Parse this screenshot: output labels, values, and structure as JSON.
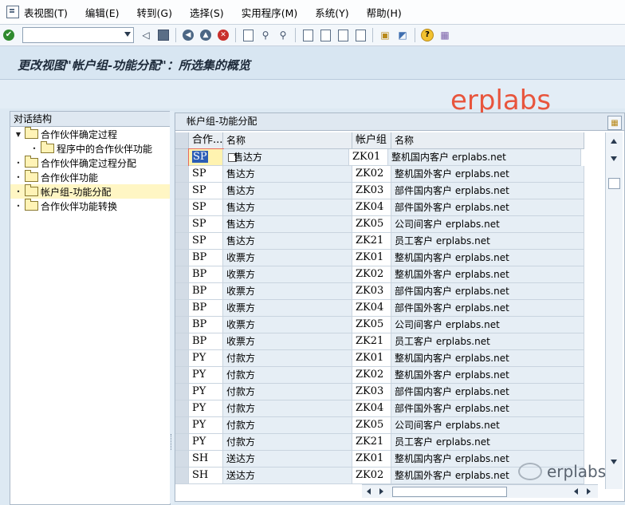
{
  "menu": [
    "表视图(T)",
    "编辑(E)",
    "转到(G)",
    "选择(S)",
    "实用程序(M)",
    "系统(Y)",
    "帮助(H)"
  ],
  "toolbar": {
    "command_value": ""
  },
  "title": "更改视图\"帐户组-功能分配\"：所选集的概览",
  "watermark_top": "erplabs",
  "tree": {
    "header": "对话结构",
    "items": [
      {
        "label": "合作伙伴确定过程",
        "toggle": "▼",
        "indent": 0
      },
      {
        "label": "程序中的合作伙伴功能",
        "toggle": "•",
        "indent": 1
      },
      {
        "label": "合作伙伴确定过程分配",
        "toggle": "•",
        "indent": 0
      },
      {
        "label": "合作伙伴功能",
        "toggle": "•",
        "indent": 0
      },
      {
        "label": "帐户组-功能分配",
        "toggle": "•",
        "indent": 0,
        "selected": true
      },
      {
        "label": "合作伙伴功能转换",
        "toggle": "•",
        "indent": 0
      }
    ]
  },
  "table": {
    "title": "帐户组-功能分配",
    "columns": [
      "合作...",
      "名称",
      "帐户组",
      "名称"
    ],
    "rows": [
      [
        "SP",
        "售达方",
        "ZK01",
        "整机国内客户 erplabs.net"
      ],
      [
        "SP",
        "售达方",
        "ZK02",
        "整机国外客户 erplabs.net"
      ],
      [
        "SP",
        "售达方",
        "ZK03",
        "部件国内客户 erplabs.net"
      ],
      [
        "SP",
        "售达方",
        "ZK04",
        "部件国外客户 erplabs.net"
      ],
      [
        "SP",
        "售达方",
        "ZK05",
        "公司间客户 erplabs.net"
      ],
      [
        "SP",
        "售达方",
        "ZK21",
        "员工客户 erplabs.net"
      ],
      [
        "BP",
        "收票方",
        "ZK01",
        "整机国内客户 erplabs.net"
      ],
      [
        "BP",
        "收票方",
        "ZK02",
        "整机国外客户 erplabs.net"
      ],
      [
        "BP",
        "收票方",
        "ZK03",
        "部件国内客户 erplabs.net"
      ],
      [
        "BP",
        "收票方",
        "ZK04",
        "部件国外客户 erplabs.net"
      ],
      [
        "BP",
        "收票方",
        "ZK05",
        "公司间客户 erplabs.net"
      ],
      [
        "BP",
        "收票方",
        "ZK21",
        "员工客户 erplabs.net"
      ],
      [
        "PY",
        "付款方",
        "ZK01",
        "整机国内客户 erplabs.net"
      ],
      [
        "PY",
        "付款方",
        "ZK02",
        "整机国外客户 erplabs.net"
      ],
      [
        "PY",
        "付款方",
        "ZK03",
        "部件国内客户 erplabs.net"
      ],
      [
        "PY",
        "付款方",
        "ZK04",
        "部件国外客户 erplabs.net"
      ],
      [
        "PY",
        "付款方",
        "ZK05",
        "公司间客户 erplabs.net"
      ],
      [
        "PY",
        "付款方",
        "ZK21",
        "员工客户 erplabs.net"
      ],
      [
        "SH",
        "送达方",
        "ZK01",
        "整机国内客户 erplabs.net"
      ],
      [
        "SH",
        "送达方",
        "ZK02",
        "整机国外客户 erplabs.net"
      ]
    ]
  },
  "watermark_bottom": "erplabs"
}
